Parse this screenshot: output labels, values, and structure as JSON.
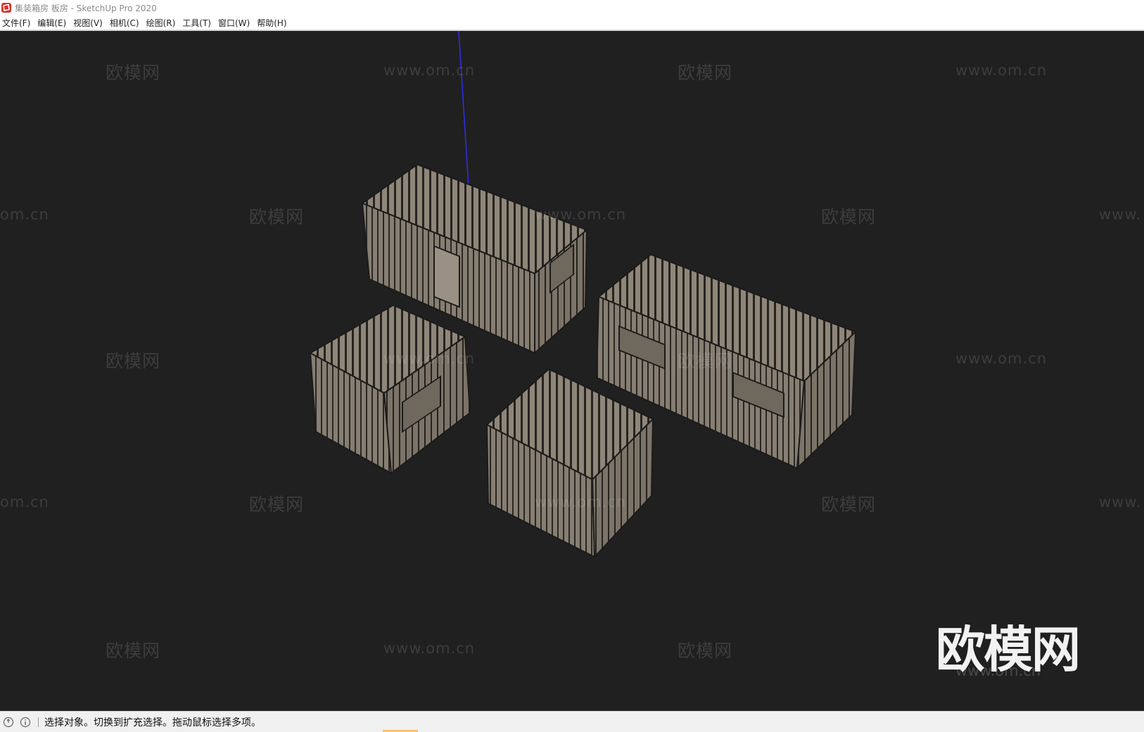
{
  "window": {
    "title": "集装箱房 板房 - SketchUp Pro 2020",
    "icon": "sketchup-logo-icon",
    "background": "#ffffff"
  },
  "menu": [
    "文件(F)",
    "编辑(E)",
    "视图(V)",
    "相机(C)",
    "绘图(R)",
    "工具(T)",
    "窗口(W)",
    "帮助(H)"
  ],
  "viewport": {
    "background": "#202020",
    "container_color": "#8d8478",
    "axis_color": "#2b2ee0",
    "models": [
      "container-long-door",
      "container-long-windows",
      "container-small-window",
      "container-small-doors"
    ]
  },
  "watermarks": {
    "brand": "欧模网",
    "url": "www.om.cn",
    "url_partial_left": "om.cn",
    "url_partial_right": "www."
  },
  "status": {
    "icons": [
      "geo-location-icon",
      "info-icon"
    ],
    "message": "选择对象。切换到扩充选择。拖动鼠标选择多项。"
  }
}
